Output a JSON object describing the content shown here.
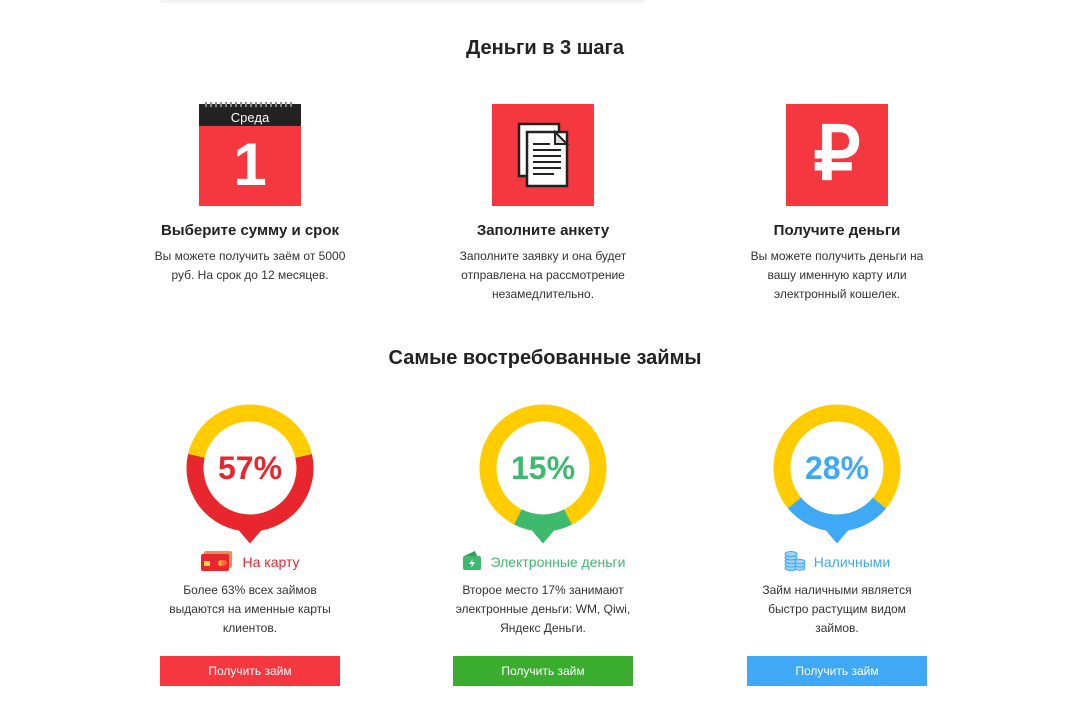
{
  "steps_section": {
    "title": "Деньги в 3 шага",
    "steps": [
      {
        "calendar_day": "Среда",
        "calendar_number": "1",
        "title": "Выберите сумму и срок",
        "text": "Вы можете получить заём от 5000 руб. На срок до 12 месяцев."
      },
      {
        "title": "Заполните анкету",
        "text": "Заполните заявку и она будет отправлена на рассмотрение незамедлительно."
      },
      {
        "symbol": "₽",
        "title": "Получите деньги",
        "text": "Вы можете получить деньги на вашу именную карту или электронный кошелек."
      }
    ]
  },
  "loans_section": {
    "title": "Самые востребованные займы",
    "cards": [
      {
        "percent": "57%",
        "percent_value": 57,
        "label": "На карту",
        "text": "Более 63% всех займов выдаются на именные карты клиентов.",
        "button": "Получить займ",
        "accent": "#e8262e",
        "ring_top": "#ffcc00",
        "button_color": "#f5383f",
        "icon": "credit-card-icon"
      },
      {
        "percent": "15%",
        "percent_value": 15,
        "label": "Электронные деньги",
        "text": "Второе место 17% занимают электронные деньги: WM, Qiwi, Яндекс Деньги.",
        "button": "Получить займ",
        "accent": "#3dba6e",
        "ring_top": "#ffcc00",
        "button_color": "#3aad2f",
        "icon": "wallet-icon"
      },
      {
        "percent": "28%",
        "percent_value": 28,
        "label": "Наличными",
        "text": "Займ наличными является быстро растущим видом займов.",
        "button": "Получить займ",
        "accent": "#3fa9f5",
        "ring_top": "#ffcc00",
        "button_color": "#3fa9f5",
        "icon": "coins-icon"
      }
    ]
  }
}
